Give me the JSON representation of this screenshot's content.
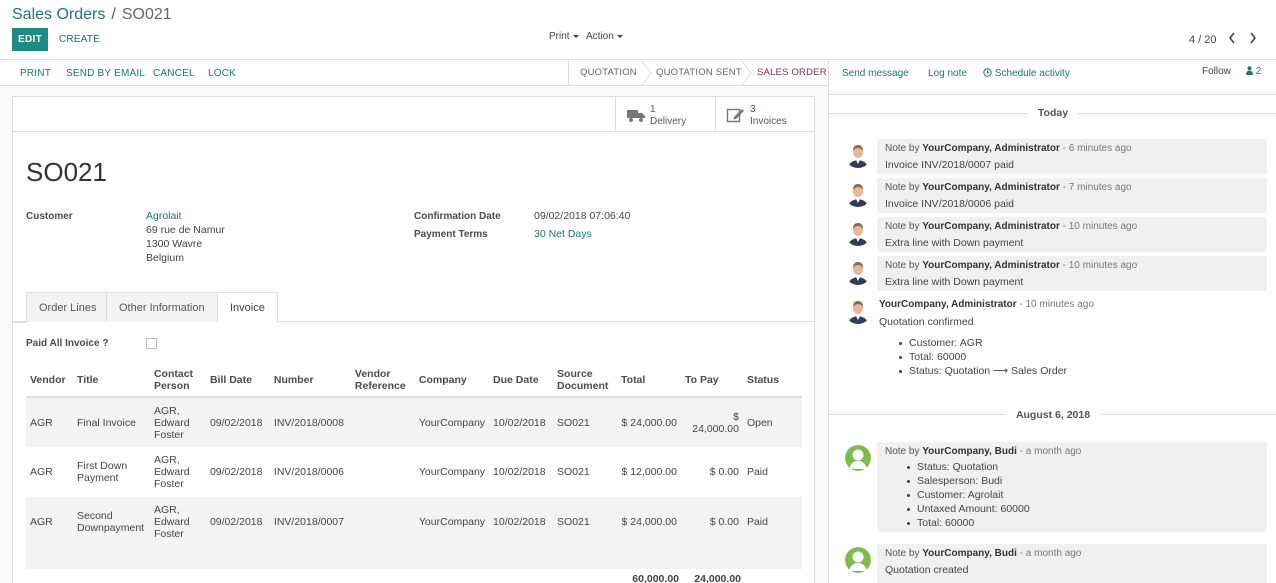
{
  "breadcrumb": {
    "parent": "Sales Orders",
    "separator": "/",
    "current": "SO021"
  },
  "buttons": {
    "edit": "EDIT",
    "create": "CREATE",
    "print_dd": "Print",
    "action_dd": "Action"
  },
  "pager": {
    "text": "4 / 20"
  },
  "statusbar": {
    "actions": [
      "PRINT",
      "SEND BY EMAIL",
      "CANCEL",
      "LOCK"
    ],
    "stages": [
      "QUOTATION",
      "QUOTATION SENT",
      "SALES ORDER"
    ],
    "active_stage": "SALES ORDER"
  },
  "smart_buttons": [
    {
      "count": "1",
      "label": "Delivery",
      "icon": "truck-icon"
    },
    {
      "count": "3",
      "label": "Invoices",
      "icon": "edit-invoice-icon"
    }
  ],
  "order": {
    "name": "SO021",
    "customer_label": "Customer",
    "customer_name": "Agrolait",
    "customer_address": [
      "69 rue de Namur",
      "1300 Wavre",
      "Belgium"
    ],
    "confirmation_label": "Confirmation Date",
    "confirmation_value": "09/02/2018 07:06:40",
    "terms_label": "Payment Terms",
    "terms_value": "30 Net Days"
  },
  "tabs": [
    "Order Lines",
    "Other Information",
    "Invoice"
  ],
  "active_tab": "Invoice",
  "paid_all_label": "Paid All Invoice ?",
  "invoice_table": {
    "headers": [
      "Vendor",
      "Title",
      "Contact Person",
      "Bill Date",
      "Number",
      "Vendor Reference",
      "Company",
      "Due Date",
      "Source Document",
      "Total",
      "To Pay",
      "Status"
    ],
    "rows": [
      [
        "AGR",
        "Final Invoice",
        "AGR, Edward Foster",
        "09/02/2018",
        "INV/2018/0008",
        "",
        "YourCompany",
        "10/02/2018",
        "SO021",
        "$ 24,000.00",
        "$ 24,000.00",
        "Open"
      ],
      [
        "AGR",
        "First Down Payment",
        "AGR, Edward Foster",
        "09/02/2018",
        "INV/2018/0006",
        "",
        "YourCompany",
        "10/02/2018",
        "SO021",
        "$ 12,000.00",
        "$ 0.00",
        "Paid"
      ],
      [
        "AGR",
        "Second Downpayment",
        "AGR, Edward Foster",
        "09/02/2018",
        "INV/2018/0007",
        "",
        "YourCompany",
        "10/02/2018",
        "SO021",
        "$ 24,000.00",
        "$ 0.00",
        "Paid"
      ]
    ],
    "total_sum": "60,000.00",
    "to_pay_sum": "24,000.00"
  },
  "chatter": {
    "send_message": "Send message",
    "log_note": "Log note",
    "schedule_activity": "Schedule activity",
    "follow": "Follow",
    "followers_count": "2",
    "day1": "Today",
    "day2": "August 6, 2018",
    "messages": [
      {
        "prefix": "Note by ",
        "author": "YourCompany, Administrator",
        "time": " - 6 minutes ago",
        "body": "Invoice INV/2018/0007 paid"
      },
      {
        "prefix": "Note by ",
        "author": "YourCompany, Administrator",
        "time": " - 7 minutes ago",
        "body": "Invoice INV/2018/0006 paid"
      },
      {
        "prefix": "Note by ",
        "author": "YourCompany, Administrator",
        "time": " - 10 minutes ago",
        "body": "Extra line with Down payment"
      },
      {
        "prefix": "Note by ",
        "author": "YourCompany, Administrator",
        "time": " - 10 minutes ago",
        "body": "Extra line with Down payment"
      },
      {
        "prefix": "",
        "author": "YourCompany, Administrator",
        "time": " - 10 minutes ago",
        "body": "Quotation confirmed",
        "bullets": [
          "Customer: AGR",
          "Total: 60000",
          "Status: Quotation ⟶ Sales Order"
        ]
      },
      {
        "prefix": "Note by ",
        "author": "YourCompany, Budi",
        "time": " - a month ago",
        "bullets": [
          "Status: Quotation",
          "Salesperson: Budi",
          "Customer: Agrolait",
          "Untaxed Amount: 60000",
          "Total: 60000"
        ]
      },
      {
        "prefix": "Note by ",
        "author": "YourCompany, Budi",
        "time": " - a month ago",
        "body": "Quotation created"
      }
    ]
  }
}
